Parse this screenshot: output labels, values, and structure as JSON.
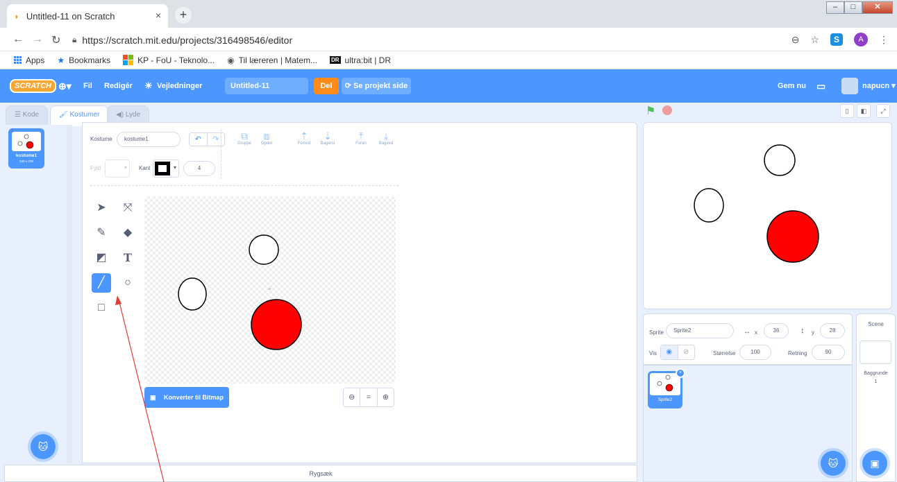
{
  "browser": {
    "tab_title": "Untitled-11 on Scratch",
    "tab_close": "×",
    "new_tab": "+",
    "url": "https://scratch.mit.edu/projects/316498546/editor",
    "profile_initial": "A",
    "bookmarks": [
      {
        "label": "Apps"
      },
      {
        "label": "Bookmarks"
      },
      {
        "label": "KP - FoU - Teknolo..."
      },
      {
        "label": "Til læreren | Matem..."
      },
      {
        "label": "ultra:bit | DR"
      }
    ]
  },
  "menubar": {
    "logo": "SCRATCH",
    "file": "Fil",
    "edit": "Redigér",
    "tutorials": "Vejledninger",
    "project_title": "Untitled-11",
    "share": "Del",
    "see_project": "Se projekt side",
    "save_now": "Gem nu",
    "username": "napucn"
  },
  "tabs": {
    "code": "Kode",
    "costumes": "Kostumer",
    "sounds": "Lyde"
  },
  "costume_list": {
    "items": [
      {
        "index": "1",
        "name": "kostume1",
        "size": "240 x 228"
      }
    ]
  },
  "paint_editor": {
    "costume_label": "Kostume",
    "costume_name": "kostume1",
    "group": "Gruppe",
    "ungroup": "Opdel",
    "forward": "Forrest",
    "backward": "Bagerst",
    "front": "Foran",
    "back": "Bagved",
    "fill_label": "Fyld",
    "outline_label": "Kant",
    "outline_width": "4",
    "convert_bitmap": "Konverter til Bitmap",
    "zoom_out": "−",
    "zoom_reset": "=",
    "zoom_in": "+",
    "selected_tool": "line"
  },
  "backpack": {
    "label": "Rygsæk"
  },
  "sprite_info": {
    "sprite_label": "Sprite",
    "sprite_name": "Sprite2",
    "x_label": "x",
    "x_value": "36",
    "y_label": "y",
    "y_value": "28",
    "show_label": "Vis",
    "size_label": "Størrelse",
    "size_value": "100",
    "direction_label": "Retning",
    "direction_value": "90"
  },
  "sprites": [
    {
      "name": "Sprite2"
    }
  ],
  "scene": {
    "title": "Scene",
    "backdrops_label": "Baggrunde",
    "backdrops_count": "1"
  },
  "colors": {
    "scratch_blue": "#4c97ff",
    "share_orange": "#ff8c1a",
    "circle_red": "#ff0000",
    "annotation_arrow": "#e53935"
  }
}
